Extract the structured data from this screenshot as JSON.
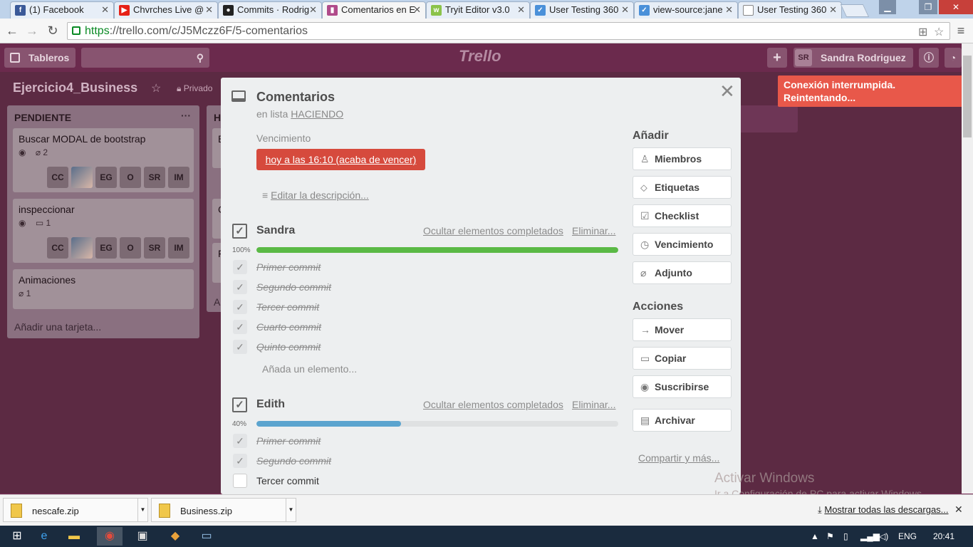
{
  "browser": {
    "tabs": [
      {
        "label": "(1) Facebook",
        "icon": "facebook-icon",
        "color": "#3b5998"
      },
      {
        "label": "Chvrches Live @",
        "icon": "youtube-icon",
        "color": "#e62117"
      },
      {
        "label": "Commits · Rodrig",
        "icon": "github-icon",
        "color": "#222222"
      },
      {
        "label": "Comentarios en E",
        "icon": "trello-icon",
        "color": "#b04a8a"
      },
      {
        "label": "Tryit Editor v3.0",
        "icon": "w3schools-icon",
        "color": "#8bc34a"
      },
      {
        "label": "User Testing 360",
        "icon": "checkbox-tab-icon",
        "color": "#4a90d9"
      },
      {
        "label": "view-source:jane",
        "icon": "checkbox-tab-icon",
        "color": "#4a90d9"
      },
      {
        "label": "User Testing 360",
        "icon": "page-icon",
        "color": "#888888"
      }
    ],
    "url_scheme": "https",
    "url_rest": "://trello.com/c/J5Mczz6F/5-comentarios"
  },
  "header": {
    "boards_label": "Tableros",
    "logo": "Trello",
    "user_initials": "SR",
    "user_name": "Sandra Rodriguez"
  },
  "board": {
    "title": "Ejercicio4_Business",
    "visibility": "Privado",
    "lists": [
      {
        "title": "PENDIENTE",
        "menu": "···",
        "cards": [
          {
            "title": "Buscar MODAL de bootstrap",
            "badge_count": "2",
            "members": [
              "CC",
              "",
              "EG",
              "O",
              "SR",
              "IM"
            ]
          },
          {
            "title": "inspeccionar",
            "badge_count": "1",
            "members": [
              "CC",
              "",
              "EG",
              "O",
              "SR",
              "IM"
            ]
          },
          {
            "title": "Animaciones",
            "badge_count": "1",
            "members": []
          }
        ],
        "add_card": "Añadir una tarjeta..."
      },
      {
        "title": "H",
        "partial": [
          "B",
          "C",
          "F",
          "A"
        ]
      }
    ]
  },
  "modal": {
    "title": "Comentarios",
    "in_list_prefix": "en lista",
    "list_name": "HACIENDO",
    "due_label": "Vencimiento",
    "due_value": "hoy a las 16:10 (acaba de vencer)",
    "edit_description": "Editar la descripción...",
    "checklists": [
      {
        "title": "Sandra",
        "hide_completed": "Ocultar elementos completados",
        "delete": "Eliminar...",
        "percent_label": "100%",
        "progress": 1.0,
        "bar_color": "#5ab945",
        "items": [
          {
            "text": "Primer commit",
            "done": true
          },
          {
            "text": "Segundo commit",
            "done": true
          },
          {
            "text": "Tercer commit",
            "done": true
          },
          {
            "text": "Cuarto commit",
            "done": true
          },
          {
            "text": "Quinto commit",
            "done": true
          }
        ],
        "add_item": "Añada un elemento..."
      },
      {
        "title": "Edith",
        "hide_completed": "Ocultar elementos completados",
        "delete": "Eliminar...",
        "percent_label": "40%",
        "progress": 0.4,
        "bar_color": "#5ba4cf",
        "items": [
          {
            "text": "Primer commit",
            "done": true
          },
          {
            "text": "Segundo commit",
            "done": true
          },
          {
            "text": "Tercer commit",
            "done": false
          }
        ]
      }
    ],
    "sidebar": {
      "add_heading": "Añadir",
      "add_buttons": [
        {
          "label": "Miembros",
          "icon": "person-icon"
        },
        {
          "label": "Etiquetas",
          "icon": "tag-icon"
        },
        {
          "label": "Checklist",
          "icon": "checklist-icon"
        },
        {
          "label": "Vencimiento",
          "icon": "clock-icon"
        },
        {
          "label": "Adjunto",
          "icon": "paperclip-icon"
        }
      ],
      "actions_heading": "Acciones",
      "action_buttons": [
        {
          "label": "Mover",
          "icon": "arrow-right-icon"
        },
        {
          "label": "Copiar",
          "icon": "copy-icon"
        },
        {
          "label": "Suscribirse",
          "icon": "eye-icon"
        },
        {
          "label": "Archivar",
          "icon": "archive-icon"
        }
      ],
      "share": "Compartir y más..."
    }
  },
  "alert": {
    "text": "Conexión interrumpida. Reintentando..."
  },
  "watermark": {
    "line1": "Activar Windows",
    "line2": "Ir a Configuración de PC para activar Windows."
  },
  "downloads": {
    "files": [
      "nescafe.zip",
      "Business.zip"
    ],
    "show_all": "Mostrar todas las descargas..."
  },
  "taskbar": {
    "lang": "ENG",
    "time": "20:41"
  }
}
